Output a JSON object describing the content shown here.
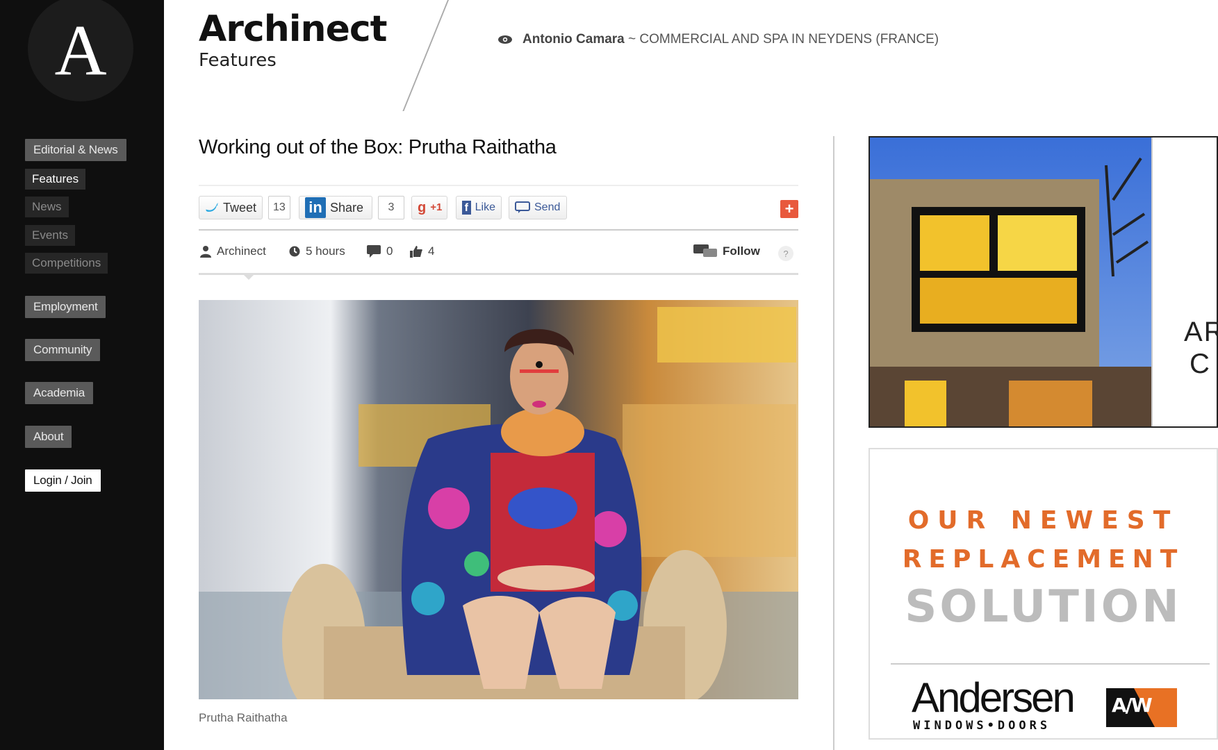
{
  "sidebar": {
    "logo_letter": "A",
    "items": [
      {
        "label": "Editorial & News"
      },
      {
        "label": "Features"
      },
      {
        "label": "News"
      },
      {
        "label": "Events"
      },
      {
        "label": "Competitions"
      },
      {
        "label": "Employment"
      },
      {
        "label": "Community"
      },
      {
        "label": "Academia"
      },
      {
        "label": "About"
      },
      {
        "label": "Login / Join"
      }
    ]
  },
  "header": {
    "brand": "Archinect",
    "section": "Features",
    "featured_name": "Antonio Camara",
    "featured_text": "~ COMMERCIAL AND SPA IN NEYDENS (FRANCE)"
  },
  "article": {
    "title": "Working out of the Box: Prutha Raithatha",
    "share": {
      "tweet_label": "Tweet",
      "tweet_count": "13",
      "linkedin_label": "Share",
      "linkedin_count": "3",
      "gplus_label": "+1",
      "fb_like_label": "Like",
      "fb_send_label": "Send"
    },
    "meta": {
      "author": "Archinect",
      "time": "5 hours",
      "comments": "0",
      "likes": "4",
      "follow_label": "Follow",
      "help": "?"
    },
    "caption": "Prutha Raithatha"
  },
  "ads": {
    "house_text_1": "AR",
    "house_text_2": "C",
    "andersen_line1": "OUR NEWEST",
    "andersen_line2": "REPLACEMENT",
    "andersen_line3": "SOLUTION",
    "andersen_brand": "Andersen",
    "andersen_sub": "WINDOWS•DOORS",
    "andersen_mark": "A/W"
  },
  "colors": {
    "sidebar_bg": "#0f0f0f",
    "nav_button": "#5a5a5a",
    "accent_orange": "#e26b2a",
    "plus_red": "#e8593d"
  }
}
